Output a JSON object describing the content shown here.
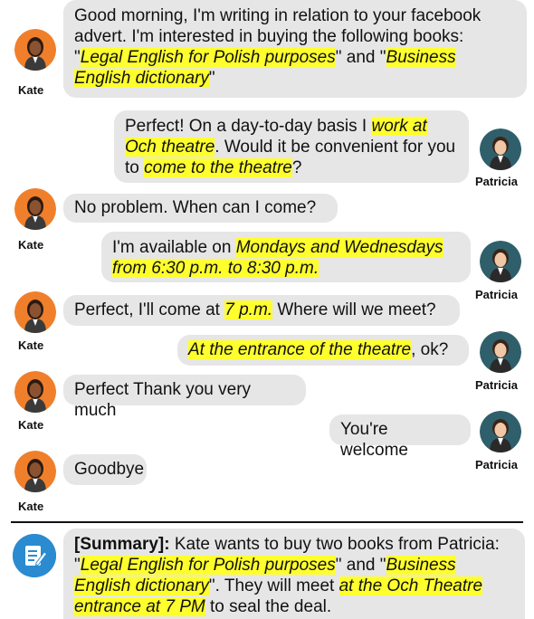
{
  "participants": {
    "left": "Kate",
    "right": "Patricia"
  },
  "messages": [
    {
      "speaker": "Kate",
      "parts": [
        {
          "t": "Good morning, I'm writing in relation to your facebook advert. I'm interested in buying the following books: \""
        },
        {
          "t": "Legal English for Polish purposes",
          "hl": true
        },
        {
          "t": "\" and \""
        },
        {
          "t": "Business English dictionary",
          "hl": true
        },
        {
          "t": "\""
        }
      ]
    },
    {
      "speaker": "Patricia",
      "parts": [
        {
          "t": "Perfect! On a day-to-day basis I "
        },
        {
          "t": "work at Och theatre",
          "hl": true
        },
        {
          "t": ". Would it be convenient for you to "
        },
        {
          "t": "come to the theatre",
          "hl": true
        },
        {
          "t": "?"
        }
      ]
    },
    {
      "speaker": "Kate",
      "parts": [
        {
          "t": "No problem. When can I come?"
        }
      ]
    },
    {
      "speaker": "Patricia",
      "parts": [
        {
          "t": "I'm available on "
        },
        {
          "t": "Mondays and Wednesdays from 6:30 p.m. to 8:30 p.m.",
          "hl": true
        }
      ]
    },
    {
      "speaker": "Kate",
      "parts": [
        {
          "t": "Perfect, I'll come at "
        },
        {
          "t": "7 p.m.",
          "hl": true
        },
        {
          "t": " Where will we meet?"
        }
      ]
    },
    {
      "speaker": "Patricia",
      "parts": [
        {
          "t": "At the entrance of the theatre",
          "hl": true
        },
        {
          "t": ", ok?"
        }
      ]
    },
    {
      "speaker": "Kate",
      "parts": [
        {
          "t": "Perfect Thank you very much"
        }
      ]
    },
    {
      "speaker": "Patricia",
      "parts": [
        {
          "t": "You're welcome"
        }
      ]
    },
    {
      "speaker": "Kate",
      "parts": [
        {
          "t": "Goodbye"
        }
      ]
    }
  ],
  "summary": {
    "label": "[Summary]:",
    "parts": [
      {
        "t": " Kate wants to buy two books from Patricia: \""
      },
      {
        "t": "Legal English for Polish purposes",
        "hl": true
      },
      {
        "t": "\" and \""
      },
      {
        "t": "Business English dictionary",
        "hl": true
      },
      {
        "t": "\". They will meet "
      },
      {
        "t": "at the Och Theatre entrance at 7 PM",
        "hl": true
      },
      {
        "t": " to seal the deal."
      }
    ]
  },
  "colors": {
    "bubble": "#e6e6e6",
    "highlight": "#ffff2e",
    "kate_avatar_bg": "#f07f2b",
    "patricia_avatar_bg": "#2f5f6b",
    "summary_icon_bg": "#2a8bd0"
  },
  "icons": {
    "kate": "woman-avatar-icon",
    "patricia": "woman-avatar-icon",
    "summary": "note-edit-icon"
  }
}
